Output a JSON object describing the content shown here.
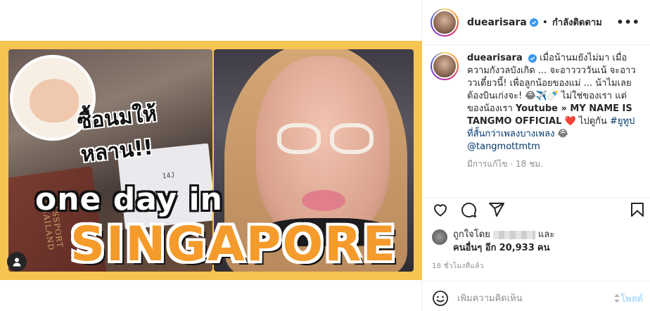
{
  "post": {
    "username": "duearisara",
    "follow_state": "กำลังติดตาม",
    "separator": "•",
    "more_menu": "•••"
  },
  "media": {
    "thai_caption": "ซื้อนมให้หลาน!!",
    "headline_small": "one day in",
    "headline_big": "SINGAPORE",
    "passport_text": "PASSPORT THAILAND",
    "ticket_text": "14J"
  },
  "caption": {
    "username": "duearisara",
    "text": "เมื่อน้านมยังไม่มา เมื่อความกังวลบังเกิด ... จะอาววววันเน้ จะอาวววเดี๋ยวนี้! เพื่อลูกน้อยของแม่ ... น้าไมเลยต้องบินเก่งจะ! 😂✈️🍼 ไม่ใช่ของเรา แต่ของน้องเรา ",
    "bold_text": "Youtube » MY NAME IS TANGMO OFFICIAL",
    "heart": "❤️",
    "text2": " ไปดูกัน ",
    "hashtag": "#ยูทูปที่สั้นกว่าเพลงบางเพลง",
    "emoji": " 😂",
    "mention": "@tangmottmtm",
    "edit_meta": "มีการแก้ไข · 18 ชม."
  },
  "likes": {
    "prefix": "ถูกใจโดย",
    "and": "และ",
    "others_prefix": "คนอื่นๆ อีก",
    "count": "20,933",
    "unit": "คน"
  },
  "time_ago": "18 ชั่วโมงที่แล้ว",
  "comment": {
    "placeholder": "เพิ่มความคิดเห็น",
    "post_label": "โพสต์"
  },
  "colors": {
    "verified": "#3897f0",
    "link": "#00376b",
    "muted": "#8e8e8e",
    "post_btn": "#b2dffc",
    "frame": "#f6c451"
  }
}
